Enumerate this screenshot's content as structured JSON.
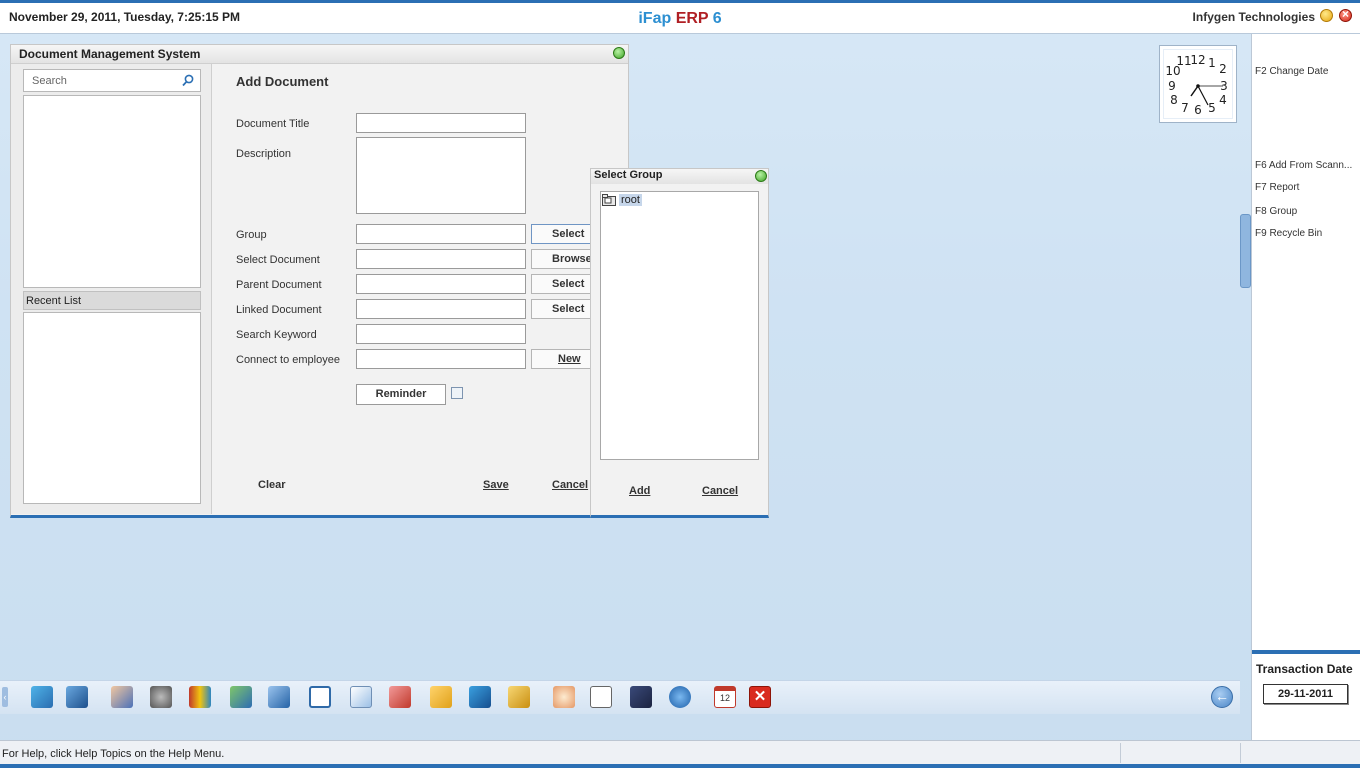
{
  "header": {
    "datetime": "November  29, 2011, Tuesday, 7:25:15 PM",
    "app_title_part1": "iFap",
    "app_title_part2": "ERP",
    "app_title_part3": "6",
    "company": "Infygen Technologies"
  },
  "right_panel": {
    "shortcuts": [
      "F2 Change Date",
      "F6 Add From Scann...",
      "F7 Report",
      "F8 Group",
      "F9 Recycle Bin"
    ],
    "transaction_date_label": "Transaction Date",
    "transaction_date_value": "29-11-2011"
  },
  "dms": {
    "window_title": "Document Management System",
    "search_placeholder": "Search",
    "recent_list_label": "Recent List",
    "form_title": "Add Document",
    "fields": {
      "document_title": "Document Title",
      "description": "Description",
      "group": "Group",
      "select_document": "Select Document",
      "parent_document": "Parent Document",
      "linked_document": "Linked Document",
      "search_keyword": "Search Keyword",
      "connect_to_employee": "Connect to employee"
    },
    "buttons": {
      "group_select": "Select",
      "browse": "Browse",
      "parent_select": "Select",
      "linked_select": "Select",
      "new": "New",
      "reminder": "Reminder",
      "clear": "Clear",
      "save": "Save",
      "cancel": "Cancel"
    }
  },
  "select_group": {
    "title": "Select Group",
    "tree_root": "root",
    "add_button": "Add",
    "cancel_button": "Cancel"
  },
  "taskbar": {
    "icons": [
      "sales-icon",
      "cleaning-icon",
      "employee-icon",
      "settings-icon",
      "books-icon",
      "cart-icon",
      "transfer-icon",
      "window-icon",
      "document-icon",
      "chart-icon",
      "folder-tree-icon",
      "network-icon",
      "box-icon",
      "calculator-icon",
      "sheet-icon",
      "save-icon",
      "gear-icon",
      "calendar-icon",
      "exit-icon"
    ],
    "calendar_day": "12"
  },
  "status_bar": {
    "help_text": "For Help, click Help Topics on the Help Menu."
  }
}
